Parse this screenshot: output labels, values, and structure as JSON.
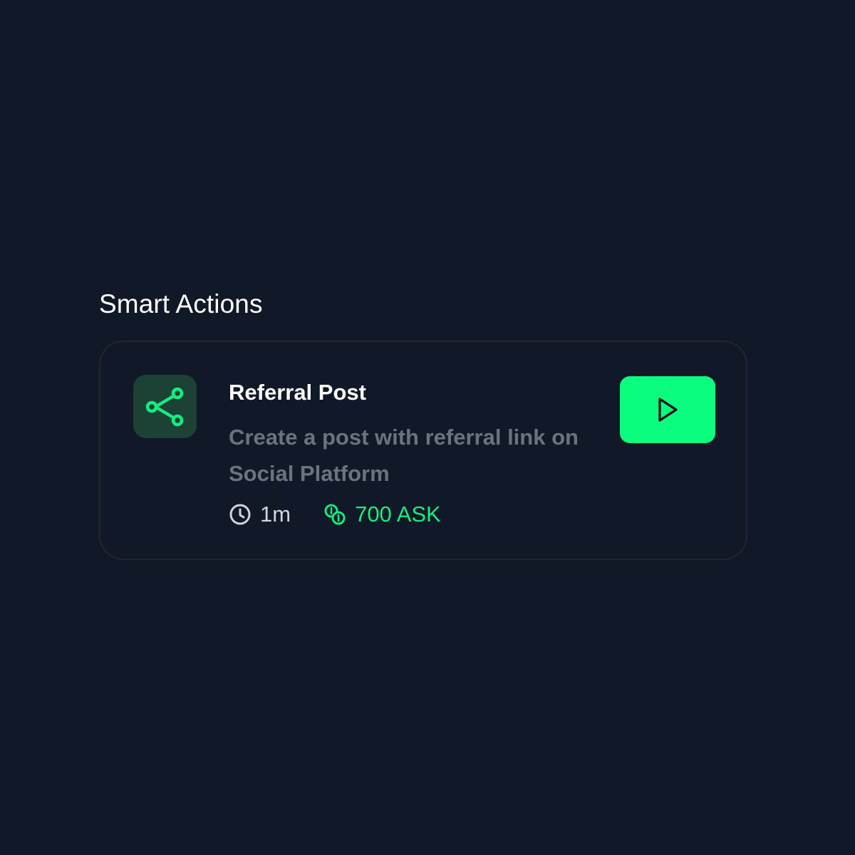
{
  "section": {
    "title": "Smart Actions"
  },
  "action": {
    "icon": "share-icon",
    "title": "Referral Post",
    "description": "Create a post with referral link on Social Platform",
    "duration": "1m",
    "reward": "700 ASK",
    "start_icon": "play-icon"
  },
  "colors": {
    "background": "#111827",
    "accent": "#0bfd80",
    "icon_tile": "#1c4235",
    "muted_text": "#6b7280"
  }
}
